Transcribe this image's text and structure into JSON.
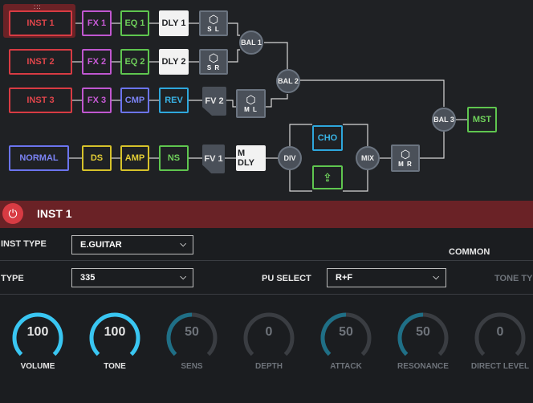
{
  "chain": {
    "row1": {
      "inst": "INST 1",
      "fx": "FX 1",
      "eq": "EQ 1",
      "dly": "DLY 1",
      "split": "S L"
    },
    "row2": {
      "inst": "INST 2",
      "fx": "FX 2",
      "eq": "EQ 2",
      "dly": "DLY 2",
      "split": "S R"
    },
    "row3": {
      "inst": "INST 3",
      "fx": "FX 3",
      "cmp": "CMP",
      "rev": "REV",
      "fv": "FV 2",
      "split": "M L"
    },
    "row4": {
      "normal": "NORMAL",
      "ds": "DS",
      "amp": "AMP",
      "ns": "NS",
      "fv": "FV 1",
      "mdly": "M DLY",
      "div": "DIV",
      "cho": "CHO",
      "mix": "MIX",
      "split": "M R"
    },
    "bal1": "BAL 1",
    "bal2": "BAL 2",
    "bal3": "BAL 3",
    "mst": "MST"
  },
  "panel": {
    "title": "INST 1",
    "inst_type_label": "INST TYPE",
    "inst_type_value": "E.GUITAR",
    "common_tab": "COMMON",
    "type_label": "TYPE",
    "type_value": "335",
    "pu_select_label": "PU SELECT",
    "pu_select_value": "R+F",
    "tone_type_label": "TONE TYP"
  },
  "knobs": [
    {
      "name": "VOLUME",
      "value": "100",
      "level": 1.0,
      "active": true
    },
    {
      "name": "TONE",
      "value": "100",
      "level": 1.0,
      "active": true
    },
    {
      "name": "SENS",
      "value": "50",
      "level": 0.5,
      "active": false
    },
    {
      "name": "DEPTH",
      "value": "0",
      "level": 0.0,
      "active": false
    },
    {
      "name": "ATTACK",
      "value": "50",
      "level": 0.5,
      "active": false
    },
    {
      "name": "RESONANCE",
      "value": "50",
      "level": 0.5,
      "active": false
    },
    {
      "name": "DIRECT LEVEL",
      "value": "0",
      "level": 0.0,
      "active": false
    }
  ],
  "colors": {
    "accent": "#39c6f2",
    "knob_track": "#3a3d42",
    "knob_dim": "#1f6f86"
  },
  "icons": {
    "power": "power-icon",
    "chevron": "chevron-down-icon",
    "split": "hex-nut-icon",
    "send": "upload-icon"
  }
}
